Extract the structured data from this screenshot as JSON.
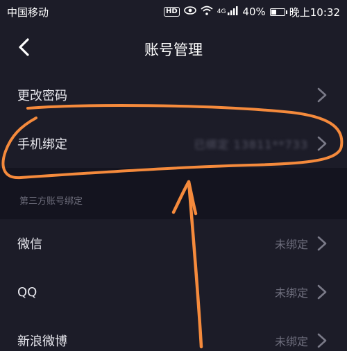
{
  "status_bar": {
    "carrier": "中国移动",
    "hd": "HD",
    "network": "4G",
    "battery_percent": "40%",
    "battery_level": 0.4,
    "time": "晚上10:32"
  },
  "nav": {
    "title": "账号管理"
  },
  "account_rows": [
    {
      "label": "更改密码",
      "value": ""
    },
    {
      "label": "手机绑定",
      "value": "已绑定 13811**733"
    }
  ],
  "third_party": {
    "header": "第三方账号绑定",
    "rows": [
      {
        "label": "微信",
        "value": "未绑定"
      },
      {
        "label": "QQ",
        "value": "未绑定"
      },
      {
        "label": "新浪微博",
        "value": "未绑定"
      }
    ]
  },
  "colors": {
    "background": "#14141f",
    "panel": "#1c1c28",
    "annotation": "#f58a3c",
    "muted_text": "#6f6f7e"
  }
}
